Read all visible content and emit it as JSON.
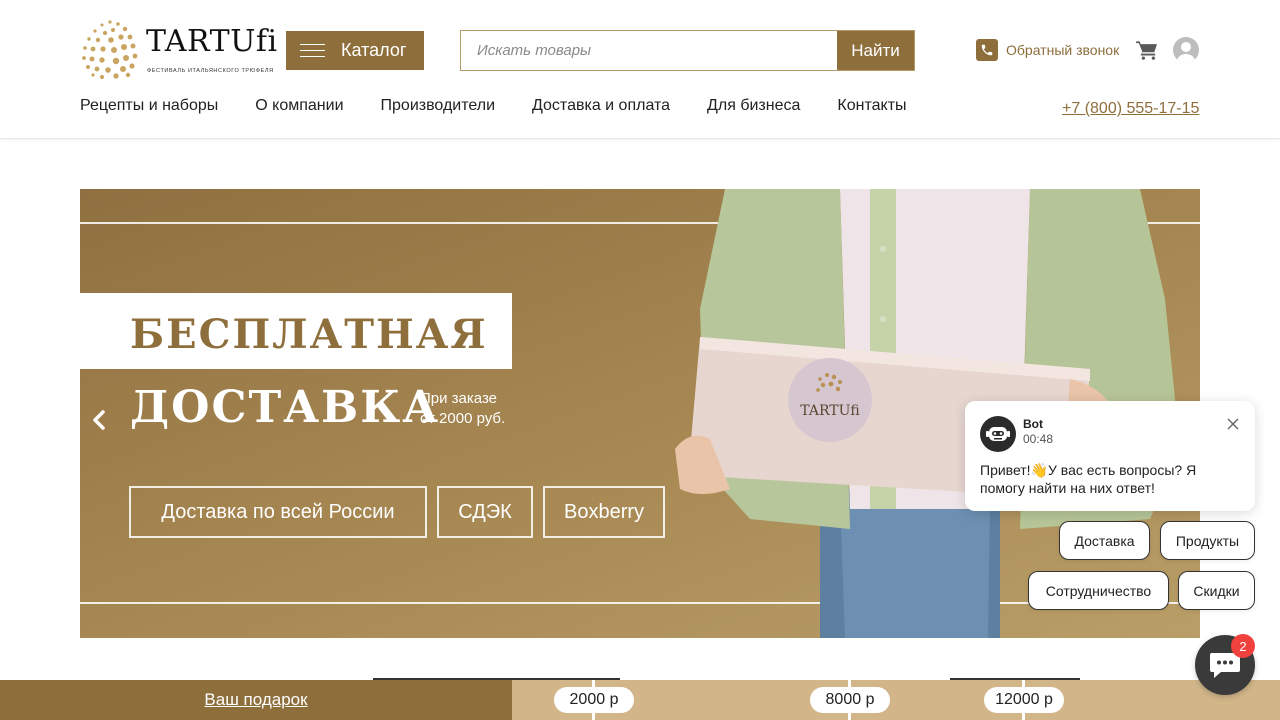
{
  "header": {
    "logo": {
      "name": "TARTUfi",
      "tagline": "ФЕСТИВАЛЬ ИТАЛЬЯНСКОГО ТРЮФЕЛЯ"
    },
    "catalog_label": "Каталог",
    "search": {
      "placeholder": "Искать товары",
      "value": "",
      "button_label": "Найти"
    },
    "callback_label": "Обратный звонок",
    "icons": [
      "phone-icon",
      "cart-icon",
      "user-icon",
      "menu-icon"
    ],
    "nav": [
      {
        "label": "Рецепты и наборы"
      },
      {
        "label": "О компании"
      },
      {
        "label": "Производители"
      },
      {
        "label": "Доставка и оплата"
      },
      {
        "label": "Для бизнеса"
      },
      {
        "label": "Контакты"
      }
    ],
    "phone": "+7 (800) 555-17-15"
  },
  "banner": {
    "headline_1": "БЕСПЛАТНАЯ",
    "headline_2": "ДОСТАВКА",
    "note_1": "При заказе",
    "note_2": "от 2000 руб.",
    "tags": [
      "Доставка по всей России",
      "СДЭК",
      "Boxberry"
    ],
    "box_logo": "TARTUfi",
    "prev_icon": "chevron-left-icon"
  },
  "gift_bar": {
    "link_label": "Ваш подарок",
    "steps": [
      "2000 р",
      "8000 р",
      "12000 р"
    ]
  },
  "chat": {
    "bot_name": "Bot",
    "time": "00:48",
    "message": "Привет!👋У вас есть вопросы? Я помогу найти на них ответ!",
    "quick_replies": [
      "Доставка",
      "Продукты",
      "Сотрудничество",
      "Скидки"
    ],
    "unread_count": "2"
  },
  "colors": {
    "brand": "#8e6f3c",
    "gift_bar": "#d2b689",
    "badge": "#f0413c"
  }
}
